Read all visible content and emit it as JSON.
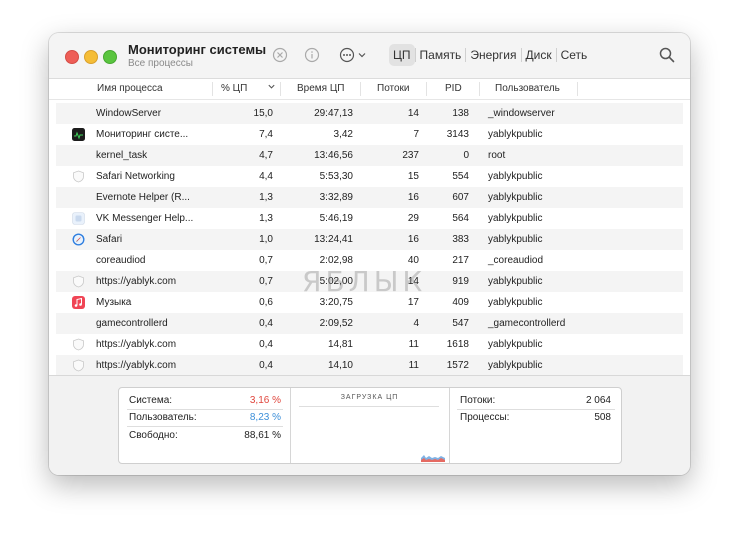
{
  "window": {
    "title": "Мониторинг системы",
    "subtitle": "Все процессы"
  },
  "toolbar": {
    "tabs": [
      {
        "label": "ЦП",
        "active": true
      },
      {
        "label": "Память",
        "active": false
      },
      {
        "label": "Энергия",
        "active": false
      },
      {
        "label": "Диск",
        "active": false
      },
      {
        "label": "Сеть",
        "active": false
      }
    ],
    "icons": [
      "stop-icon",
      "info-icon",
      "more-icon",
      "search-icon"
    ]
  },
  "columns": {
    "name": "Имя процесса",
    "cpu": "% ЦП",
    "time": "Время ЦП",
    "threads": "Потоки",
    "pid": "PID",
    "user": "Пользователь"
  },
  "processes": [
    {
      "name": "WindowServer",
      "cpu": "15,0",
      "time": "29:47,13",
      "threads": "14",
      "pid": "138",
      "user": "_windowserver",
      "icon": "none"
    },
    {
      "name": "Мониторинг систе...",
      "cpu": "7,4",
      "time": "3,42",
      "threads": "7",
      "pid": "3143",
      "user": "yablykpublic",
      "icon": "activity-monitor-icon"
    },
    {
      "name": "kernel_task",
      "cpu": "4,7",
      "time": "13:46,56",
      "threads": "237",
      "pid": "0",
      "user": "root",
      "icon": "none"
    },
    {
      "name": "Safari Networking",
      "cpu": "4,4",
      "time": "5:53,30",
      "threads": "15",
      "pid": "554",
      "user": "yablykpublic",
      "icon": "shield-icon"
    },
    {
      "name": "Evernote Helper (R...",
      "cpu": "1,3",
      "time": "3:32,89",
      "threads": "16",
      "pid": "607",
      "user": "yablykpublic",
      "icon": "none"
    },
    {
      "name": "VK Messenger Help...",
      "cpu": "1,3",
      "time": "5:46,19",
      "threads": "29",
      "pid": "564",
      "user": "yablykpublic",
      "icon": "app-icon"
    },
    {
      "name": "Safari",
      "cpu": "1,0",
      "time": "13:24,41",
      "threads": "16",
      "pid": "383",
      "user": "yablykpublic",
      "icon": "safari-icon"
    },
    {
      "name": "coreaudiod",
      "cpu": "0,7",
      "time": "2:02,98",
      "threads": "40",
      "pid": "217",
      "user": "_coreaudiod",
      "icon": "none"
    },
    {
      "name": "https://yablyk.com",
      "cpu": "0,7",
      "time": "5:02,00",
      "threads": "14",
      "pid": "919",
      "user": "yablykpublic",
      "icon": "shield-icon"
    },
    {
      "name": "Музыка",
      "cpu": "0,6",
      "time": "3:20,75",
      "threads": "17",
      "pid": "409",
      "user": "yablykpublic",
      "icon": "music-icon"
    },
    {
      "name": "gamecontrollerd",
      "cpu": "0,4",
      "time": "2:09,52",
      "threads": "4",
      "pid": "547",
      "user": "_gamecontrollerd",
      "icon": "none"
    },
    {
      "name": "https://yablyk.com",
      "cpu": "0,4",
      "time": "14,81",
      "threads": "11",
      "pid": "1618",
      "user": "yablykpublic",
      "icon": "shield-icon"
    },
    {
      "name": "https://yablyk.com",
      "cpu": "0,4",
      "time": "14,10",
      "threads": "11",
      "pid": "1572",
      "user": "yablykpublic",
      "icon": "shield-icon"
    }
  ],
  "watermark": "ЯБЛЫК",
  "summary": {
    "system_label": "Система:",
    "system_value": "3,16 %",
    "system_color": "#e0463d",
    "user_label": "Пользователь:",
    "user_value": "8,23 %",
    "user_color": "#3c8fd9",
    "idle_label": "Свободно:",
    "idle_value": "88,61 %",
    "graph_title": "ЗАГРУЗКА ЦП",
    "threads_label": "Потоки:",
    "threads_value": "2 064",
    "processes_label": "Процессы:",
    "processes_value": "508"
  }
}
